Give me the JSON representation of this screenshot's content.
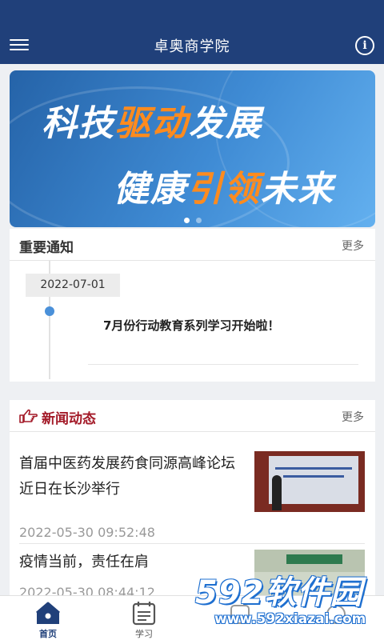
{
  "header": {
    "title": "卓奥商学院",
    "menu_icon": "hamburger-menu-icon",
    "info_icon": "info-icon",
    "info_glyph": "i",
    "bg_color": "#20407a"
  },
  "banner": {
    "line1": [
      {
        "text": "科技",
        "tone": "white"
      },
      {
        "text": "驱动",
        "tone": "orange"
      },
      {
        "text": "发展",
        "tone": "white"
      }
    ],
    "line2": [
      {
        "text": "健康",
        "tone": "white"
      },
      {
        "text": "引领",
        "tone": "orange"
      },
      {
        "text": "未来",
        "tone": "white"
      }
    ],
    "slide_count": 2,
    "active_slide": 1,
    "accent_color": "#ff8b1e"
  },
  "notice": {
    "title": "重要通知",
    "more": "更多",
    "items": [
      {
        "date": "2022-07-01",
        "text": "7月份行动教育系列学习开始啦！"
      }
    ]
  },
  "news": {
    "title": "新闻动态",
    "more": "更多",
    "title_color": "#a31a28",
    "icon": "pointing-hand-icon",
    "items": [
      {
        "title": "首届中医药发展药食同源高峰论坛近日在长沙举行",
        "date": "2022-05-30 09:52:48"
      },
      {
        "title": "疫情当前，责任在肩",
        "date": "2022-05-30 08:44:12"
      }
    ]
  },
  "tabbar": {
    "tabs": [
      {
        "label": "首页",
        "icon": "home-icon",
        "active": true
      },
      {
        "label": "学习",
        "icon": "notebook-icon",
        "active": false
      },
      {
        "label": "",
        "icon": "tab-icon",
        "active": false
      },
      {
        "label": "",
        "icon": "tab-icon",
        "active": false
      }
    ]
  },
  "watermark": {
    "brand": "592软件园",
    "url": "www.592xiazai.com"
  }
}
